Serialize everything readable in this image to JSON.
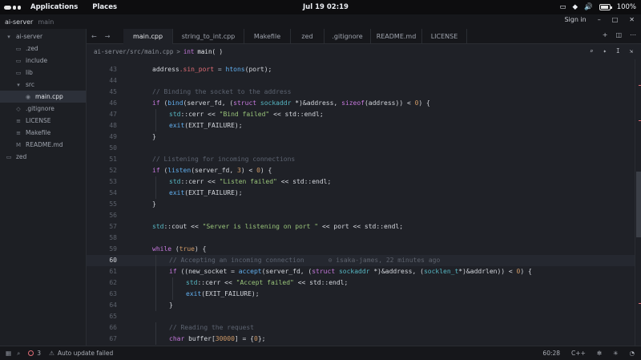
{
  "topbar": {
    "applications": "Applications",
    "places": "Places",
    "clock": "Jul 19  02:19",
    "battery": "100%"
  },
  "titlebar": {
    "project": "ai-server",
    "branch": "main",
    "signin": "Sign in"
  },
  "sidebar": {
    "items": [
      {
        "label": "ai-server",
        "icon": "folder-open-icon",
        "depth": 0
      },
      {
        "label": ".zed",
        "icon": "folder-icon",
        "depth": 1
      },
      {
        "label": "include",
        "icon": "folder-icon",
        "depth": 1
      },
      {
        "label": "lib",
        "icon": "folder-icon",
        "depth": 1
      },
      {
        "label": "src",
        "icon": "folder-open-icon",
        "depth": 1
      },
      {
        "label": "main.cpp",
        "icon": "cpp-file-icon",
        "depth": 2,
        "selected": true
      },
      {
        "label": ".gitignore",
        "icon": "git-icon",
        "depth": 1
      },
      {
        "label": "LICENSE",
        "icon": "file-icon",
        "depth": 1
      },
      {
        "label": "Makefile",
        "icon": "file-icon",
        "depth": 1
      },
      {
        "label": "README.md",
        "icon": "markdown-icon",
        "depth": 1
      },
      {
        "label": "zed",
        "icon": "folder-icon",
        "depth": 0
      }
    ]
  },
  "tabs": [
    {
      "label": "main.cpp",
      "active": true
    },
    {
      "label": "string_to_int.cpp"
    },
    {
      "label": "Makefile"
    },
    {
      "label": "zed"
    },
    {
      "label": ".gitignore"
    },
    {
      "label": "README.md"
    },
    {
      "label": "LICENSE"
    }
  ],
  "breadcrumb": {
    "path": "ai-server/src/main.cpp",
    "sep": ">",
    "kw": "int",
    "fn": "main( )"
  },
  "editor": {
    "current_line": 60,
    "blame": "isaka-james, 22 minutes ago",
    "lines": [
      {
        "n": 43,
        "i": 1,
        "t": [
          [
            "address",
            ""
          ],
          [
            ".sin_port",
            "mb"
          ],
          [
            " = ",
            "op"
          ],
          [
            "htons",
            "fn"
          ],
          [
            "(port);",
            ""
          ]
        ]
      },
      {
        "n": 44,
        "i": 0,
        "t": []
      },
      {
        "n": 45,
        "i": 1,
        "t": [
          [
            "// Binding the socket to the address",
            "co"
          ]
        ]
      },
      {
        "n": 46,
        "i": 1,
        "t": [
          [
            "if",
            "kw"
          ],
          [
            " (",
            ""
          ],
          [
            "bind",
            "fn"
          ],
          [
            "(server_fd, (",
            ""
          ],
          [
            "struct",
            "kw"
          ],
          [
            " ",
            ""
          ],
          [
            "sockaddr",
            "ty"
          ],
          [
            " *)&address, ",
            ""
          ],
          [
            "sizeof",
            "kw"
          ],
          [
            "(address)) < ",
            ""
          ],
          [
            "0",
            "nu"
          ],
          [
            ") {",
            ""
          ]
        ]
      },
      {
        "n": 47,
        "i": 2,
        "t": [
          [
            "std",
            "ty"
          ],
          [
            "::cerr << ",
            ""
          ],
          [
            "\"Bind failed\"",
            "st"
          ],
          [
            " << std::endl;",
            ""
          ]
        ]
      },
      {
        "n": 48,
        "i": 2,
        "t": [
          [
            "exit",
            "fn"
          ],
          [
            "(EXIT_FAILURE);",
            ""
          ]
        ]
      },
      {
        "n": 49,
        "i": 1,
        "t": [
          [
            "}",
            ""
          ]
        ]
      },
      {
        "n": 50,
        "i": 0,
        "t": []
      },
      {
        "n": 51,
        "i": 1,
        "t": [
          [
            "// Listening for incoming connections",
            "co"
          ]
        ]
      },
      {
        "n": 52,
        "i": 1,
        "t": [
          [
            "if",
            "kw"
          ],
          [
            " (",
            ""
          ],
          [
            "listen",
            "fn"
          ],
          [
            "(server_fd, ",
            ""
          ],
          [
            "3",
            "nu"
          ],
          [
            ") < ",
            ""
          ],
          [
            "0",
            "nu"
          ],
          [
            ") {",
            ""
          ]
        ]
      },
      {
        "n": 53,
        "i": 2,
        "t": [
          [
            "std",
            "ty"
          ],
          [
            "::cerr << ",
            ""
          ],
          [
            "\"Listen failed\"",
            "st"
          ],
          [
            " << std::endl;",
            ""
          ]
        ]
      },
      {
        "n": 54,
        "i": 2,
        "t": [
          [
            "exit",
            "fn"
          ],
          [
            "(EXIT_FAILURE);",
            ""
          ]
        ]
      },
      {
        "n": 55,
        "i": 1,
        "t": [
          [
            "}",
            ""
          ]
        ]
      },
      {
        "n": 56,
        "i": 0,
        "t": []
      },
      {
        "n": 57,
        "i": 1,
        "t": [
          [
            "std",
            "ty"
          ],
          [
            "::cout << ",
            ""
          ],
          [
            "\"Server is listening on port \"",
            "st"
          ],
          [
            " << port << std::endl;",
            ""
          ]
        ]
      },
      {
        "n": 58,
        "i": 0,
        "t": []
      },
      {
        "n": 59,
        "i": 1,
        "t": [
          [
            "while",
            "kw"
          ],
          [
            " (",
            ""
          ],
          [
            "true",
            "nu"
          ],
          [
            ") {",
            ""
          ]
        ]
      },
      {
        "n": 60,
        "i": 2,
        "t": [
          [
            "// Accepting an incoming connection",
            "co"
          ]
        ],
        "blame": true
      },
      {
        "n": 61,
        "i": 2,
        "t": [
          [
            "if",
            "kw"
          ],
          [
            " ((new_socket = ",
            ""
          ],
          [
            "accept",
            "fn"
          ],
          [
            "(server_fd, (",
            ""
          ],
          [
            "struct",
            "kw"
          ],
          [
            " ",
            ""
          ],
          [
            "sockaddr",
            "ty"
          ],
          [
            " *)&address, (",
            ""
          ],
          [
            "socklen_t",
            "ty"
          ],
          [
            "*)&addrlen)) < ",
            ""
          ],
          [
            "0",
            "nu"
          ],
          [
            ") {",
            ""
          ]
        ]
      },
      {
        "n": 62,
        "i": 3,
        "t": [
          [
            "std",
            "ty"
          ],
          [
            "::cerr << ",
            ""
          ],
          [
            "\"Accept failed\"",
            "st"
          ],
          [
            " << std::endl;",
            ""
          ]
        ]
      },
      {
        "n": 63,
        "i": 3,
        "t": [
          [
            "exit",
            "fn"
          ],
          [
            "(EXIT_FAILURE);",
            ""
          ]
        ]
      },
      {
        "n": 64,
        "i": 2,
        "t": [
          [
            "}",
            ""
          ]
        ]
      },
      {
        "n": 65,
        "i": 0,
        "t": []
      },
      {
        "n": 66,
        "i": 2,
        "t": [
          [
            "// Reading the request",
            "co"
          ]
        ]
      },
      {
        "n": 67,
        "i": 2,
        "t": [
          [
            "char",
            "kw"
          ],
          [
            " buffer[",
            ""
          ],
          [
            "30000",
            "nu"
          ],
          [
            "] = {",
            ""
          ],
          [
            "0",
            "nu"
          ],
          [
            "};",
            ""
          ]
        ]
      }
    ]
  },
  "statusbar": {
    "errors": "3",
    "message": "Auto update failed",
    "position": "60:28",
    "language": "C++"
  },
  "colors": {
    "accent": "#61afef",
    "error": "#e06c75",
    "background": "#1f2127"
  }
}
